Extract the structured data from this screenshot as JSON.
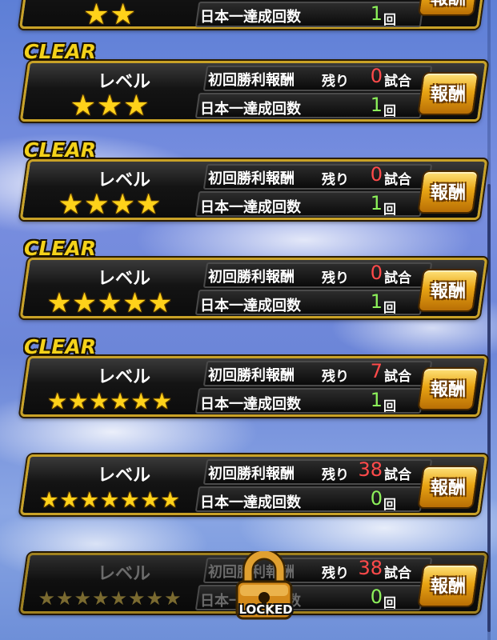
{
  "labels": {
    "clear": "CLEAR",
    "level": "レベル",
    "first_win_reward": "初回勝利報酬",
    "remaining": "残り",
    "matches": "試合",
    "japan_champion_count": "日本一達成回数",
    "times": "回",
    "reward_button": "報酬",
    "locked": "LOCKED"
  },
  "colors": {
    "star_gold": "#ffd21a",
    "remaining_count_red": "#ff4a4a",
    "achieved_count_green": "#8cf05a",
    "clear_text": "#f4d21a",
    "panel_border": "#c9a227"
  },
  "levels": [
    {
      "stars": 2,
      "cleared": true,
      "remaining_matches": "",
      "japan_champion_count": "1",
      "locked": false
    },
    {
      "stars": 3,
      "cleared": true,
      "remaining_matches": "0",
      "japan_champion_count": "1",
      "locked": false
    },
    {
      "stars": 4,
      "cleared": true,
      "remaining_matches": "0",
      "japan_champion_count": "1",
      "locked": false
    },
    {
      "stars": 5,
      "cleared": true,
      "remaining_matches": "0",
      "japan_champion_count": "1",
      "locked": false
    },
    {
      "stars": 6,
      "cleared": true,
      "remaining_matches": "7",
      "japan_champion_count": "1",
      "locked": false
    },
    {
      "stars": 7,
      "cleared": false,
      "remaining_matches": "38",
      "japan_champion_count": "0",
      "locked": false
    },
    {
      "stars": 8,
      "cleared": false,
      "remaining_matches": "38",
      "japan_champion_count": "0",
      "locked": true
    }
  ],
  "icons": {
    "star": "star-icon",
    "lock": "padlock-icon"
  }
}
